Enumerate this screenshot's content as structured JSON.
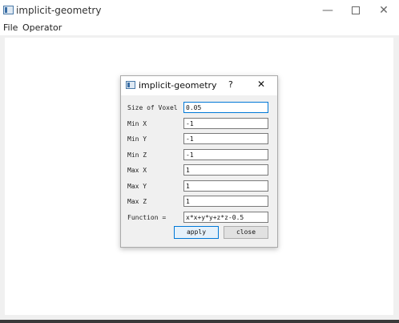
{
  "window": {
    "title": "implicit-geometry",
    "controls": {
      "minimize": "—",
      "close": "✕"
    }
  },
  "menubar": {
    "items": [
      "File",
      "Operator"
    ]
  },
  "dialog": {
    "title": "implicit-geometry",
    "help": "?",
    "close": "✕",
    "fields": [
      {
        "label": "Size of Voxel",
        "value": "0.05"
      },
      {
        "label": "Min X",
        "value": "-1"
      },
      {
        "label": "Min Y",
        "value": "-1"
      },
      {
        "label": "Min Z",
        "value": "-1"
      },
      {
        "label": "Max X",
        "value": "1"
      },
      {
        "label": "Max Y",
        "value": "1"
      },
      {
        "label": "Max Z",
        "value": "1"
      },
      {
        "label": "Function =",
        "value": "x*x+y*y+z*z-0.5"
      }
    ],
    "buttons": {
      "apply": "apply",
      "close": "close"
    }
  }
}
